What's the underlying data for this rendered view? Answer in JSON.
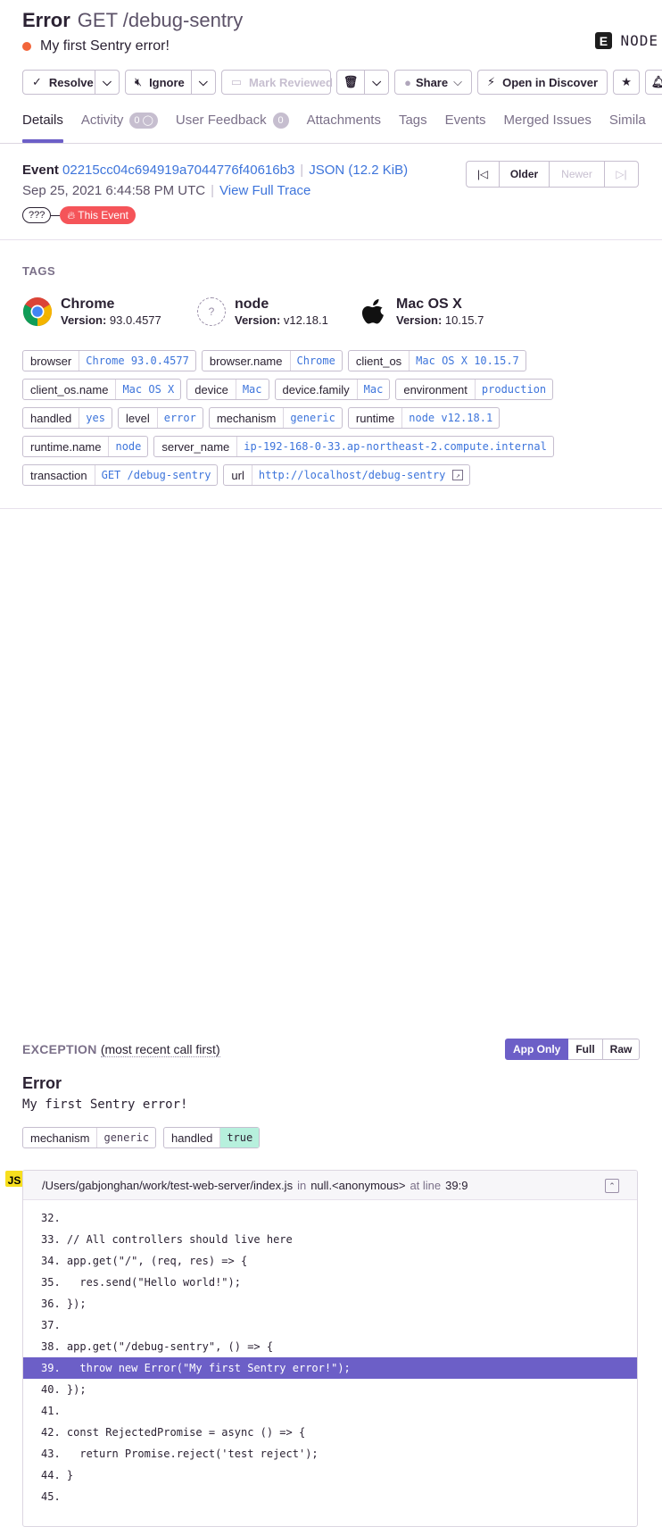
{
  "header": {
    "title": "Error",
    "subtitle": "GET /debug-sentry",
    "message": "My first Sentry error!",
    "platform": "NODE",
    "platform_logo_letter": "E"
  },
  "toolbar": {
    "resolve": "Resolve",
    "ignore": "Ignore",
    "mark_reviewed": "Mark Reviewed",
    "share": "Share",
    "open_discover": "Open in Discover"
  },
  "tabs": [
    {
      "label": "Details",
      "active": true
    },
    {
      "label": "Activity",
      "badge": "0"
    },
    {
      "label": "User Feedback",
      "badge": "0"
    },
    {
      "label": "Attachments"
    },
    {
      "label": "Tags"
    },
    {
      "label": "Events"
    },
    {
      "label": "Merged Issues"
    },
    {
      "label": "Simila"
    }
  ],
  "event": {
    "label": "Event",
    "id": "02215cc04c694919a7044776f40616b3",
    "json": "JSON (12.2 KiB)",
    "date": "Sep 25, 2021 6:44:58 PM UTC",
    "trace": "View Full Trace",
    "pill_unknown": "???",
    "pill_this": "This Event",
    "older": "Older",
    "newer": "Newer"
  },
  "tags_section": {
    "heading": "TAGS",
    "contexts": [
      {
        "name": "Chrome",
        "version_label": "Version:",
        "version": "93.0.4577"
      },
      {
        "name": "node",
        "version_label": "Version:",
        "version": "v12.18.1"
      },
      {
        "name": "Mac OS X",
        "version_label": "Version:",
        "version": "10.15.7"
      }
    ],
    "rows": [
      [
        {
          "k": "browser",
          "v": "Chrome 93.0.4577"
        },
        {
          "k": "browser.name",
          "v": "Chrome"
        },
        {
          "k": "client_os",
          "v": "Mac OS X 10.15.7"
        }
      ],
      [
        {
          "k": "client_os.name",
          "v": "Mac OS X"
        },
        {
          "k": "device",
          "v": "Mac"
        },
        {
          "k": "device.family",
          "v": "Mac"
        },
        {
          "k": "environment",
          "v": "production"
        }
      ],
      [
        {
          "k": "handled",
          "v": "yes"
        },
        {
          "k": "level",
          "v": "error"
        },
        {
          "k": "mechanism",
          "v": "generic"
        },
        {
          "k": "runtime",
          "v": "node v12.18.1"
        }
      ],
      [
        {
          "k": "runtime.name",
          "v": "node"
        },
        {
          "k": "server_name",
          "v": "ip-192-168-0-33.ap-northeast-2.compute.internal"
        }
      ],
      [
        {
          "k": "transaction",
          "v": "GET /debug-sentry"
        },
        {
          "k": "url",
          "v": "http://localhost/debug-sentry"
        }
      ]
    ]
  },
  "exception": {
    "heading": "EXCEPTION",
    "heading_sub": "(most recent call first)",
    "modes": [
      "App Only",
      "Full",
      "Raw"
    ],
    "type": "Error",
    "value": "My first Sentry error!",
    "mech_key": "mechanism",
    "mech_val": "generic",
    "handled_key": "handled",
    "handled_val": "true",
    "frame": {
      "badge": "JS",
      "file": "/Users/gabjonghan/work/test-web-server/index.js",
      "in": "in",
      "func": "null.<anonymous>",
      "at": "at line",
      "line": "39:9"
    },
    "code": [
      {
        "text": "32."
      },
      {
        "text": "33. // All controllers should live here"
      },
      {
        "text": "34. app.get(\"/\", (req, res) => {"
      },
      {
        "text": "35.   res.send(\"Hello world!\");"
      },
      {
        "text": "36. });"
      },
      {
        "text": "37."
      },
      {
        "text": "38. app.get(\"/debug-sentry\", () => {"
      },
      {
        "text": "39.   throw new Error(\"My first Sentry error!\");",
        "highlight": true
      },
      {
        "text": "40. });"
      },
      {
        "text": "41."
      },
      {
        "text": "42. const RejectedPromise = async () => {"
      },
      {
        "text": "43.   return Promise.reject('test reject');"
      },
      {
        "text": "44. }"
      },
      {
        "text": "45."
      }
    ]
  },
  "colors": {
    "accent": "#6c5fc7",
    "link": "#3d74db",
    "error_dot": "#f2653a",
    "this_event": "#f55459",
    "handled_true": "#b7f0dd"
  }
}
